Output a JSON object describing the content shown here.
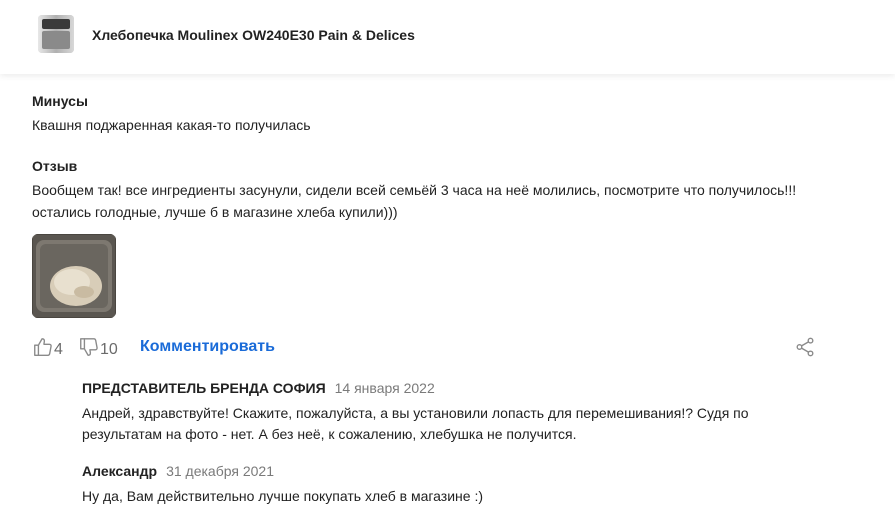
{
  "header": {
    "product_title": "Хлебопечка Moulinex OW240E30 Pain & Delices",
    "product_icon": "bread-maker-thumbnail"
  },
  "review": {
    "cons_label": "Минусы",
    "cons_text": "Квашня поджаренная какая-то получилась",
    "review_label": "Отзыв",
    "review_line1": "Вообщем так! все ингредиенты засунули, сидели всей семьёй 3 часа на неё молились, посмотрите что получилось!!!",
    "review_line2": "остались голодные, лучше б в магазине хлеба купили)))",
    "photo_icon": "bread-photo"
  },
  "actions": {
    "likes": "4",
    "dislikes": "10",
    "comment_label": "Комментировать",
    "accent_color": "#1a6bd8"
  },
  "comments": [
    {
      "author": "ПРЕДСТАВИТЕЛЬ БРЕНДА СОФИЯ",
      "date": "14 января 2022",
      "line1": "Андрей, здравствуйте! Скажите, пожалуйста, а вы установили лопасть для перемешивания!? Судя по",
      "line2": "результатам на фото - нет. А без неё, к сожалению, хлебушка не получится."
    },
    {
      "author": "Александр",
      "date": "31 декабря 2021",
      "line1": "Ну да, Вам действительно лучше покупать хлеб в магазине :)"
    }
  ]
}
